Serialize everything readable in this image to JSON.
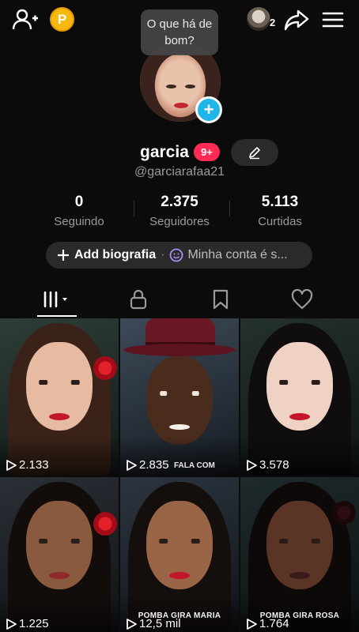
{
  "topbar": {
    "coin_label": "P",
    "friend_count": "2",
    "icons": [
      "add-user-icon",
      "coin-icon",
      "friends-avatar",
      "share-icon",
      "menu-icon"
    ]
  },
  "profile": {
    "bubble_text": "O que há de bom?",
    "plus_label": "+",
    "username": "garcia",
    "notif_badge": "9+",
    "handle": "@garciarafaa21"
  },
  "stats": [
    {
      "value": "0",
      "label": "Seguindo"
    },
    {
      "value": "2.375",
      "label": "Seguidores"
    },
    {
      "value": "5.113",
      "label": "Curtidas"
    }
  ],
  "bio": {
    "add_label": "Add biografia",
    "separator": "·",
    "account_label": "Minha conta é s..."
  },
  "tabs": [
    "grid-icon",
    "lock-icon",
    "bookmark-icon",
    "heart-icon"
  ],
  "videos": [
    {
      "views": "2.133",
      "caption": ""
    },
    {
      "views": "2.835",
      "caption": "",
      "overlay": "FALA COM"
    },
    {
      "views": "3.578",
      "caption": ""
    },
    {
      "views": "1.225",
      "caption": ""
    },
    {
      "views": "12,5 mil",
      "caption": "POMBA GIRA MARIA"
    },
    {
      "views": "1.764",
      "caption": "POMBA GIRA ROSA"
    }
  ],
  "colors": {
    "background": "#0b0b0b",
    "accent_pink": "#ff2b55",
    "plus_blue": "#20b6ea",
    "coin_gold": "#f6b90f",
    "muted_text": "#9a9a9a"
  }
}
